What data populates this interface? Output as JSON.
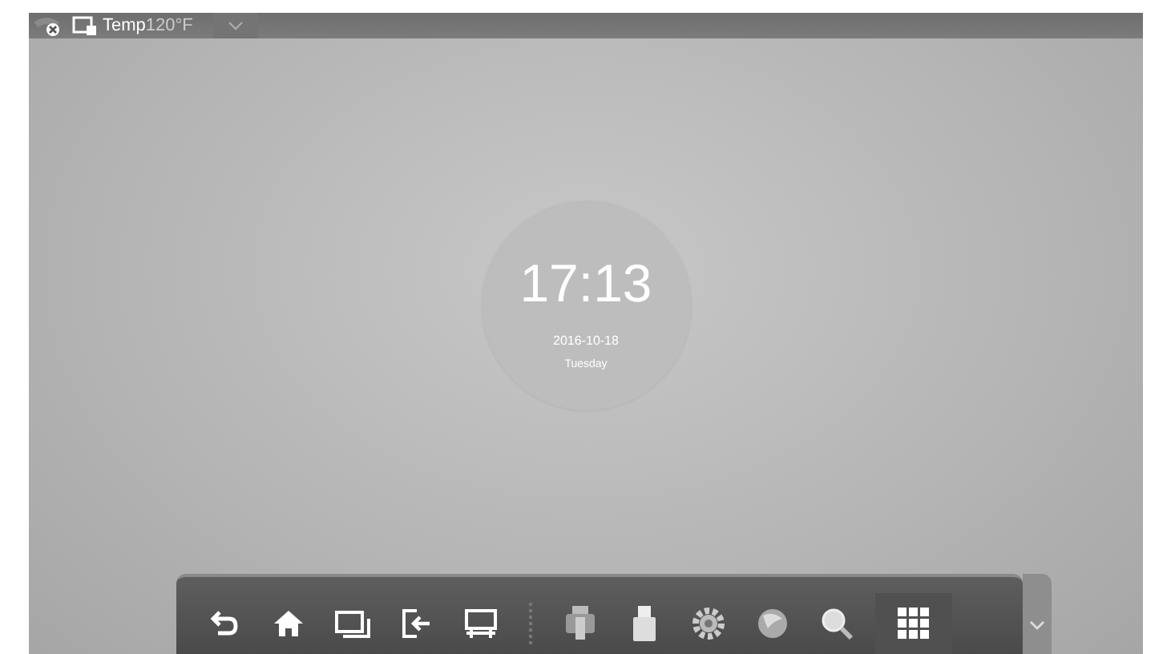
{
  "status_bar": {
    "temp_label": "Temp",
    "temp_value": "120°F"
  },
  "clock": {
    "time": "17:13",
    "date": "2016-10-18",
    "day": "Tuesday"
  }
}
